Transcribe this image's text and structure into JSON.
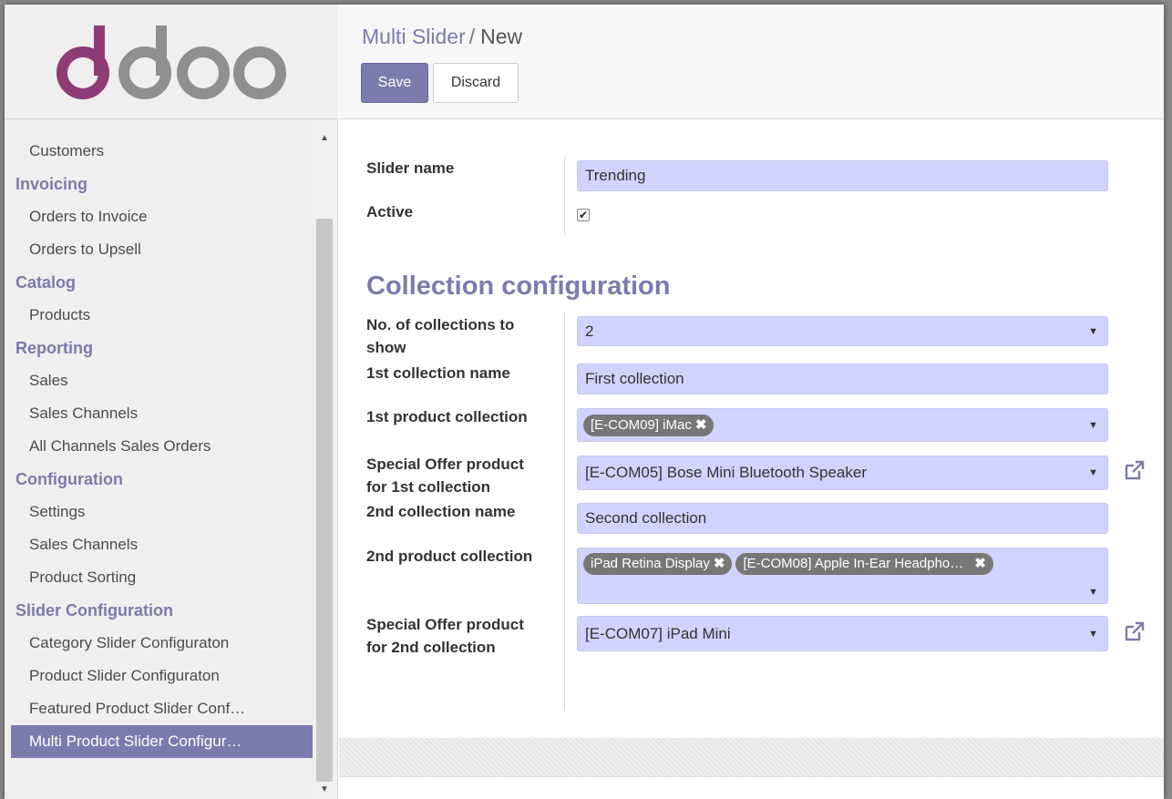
{
  "app": {
    "logo_text": "odoo"
  },
  "sidebar": {
    "groups": [
      {
        "items": [
          "Customers"
        ]
      },
      {
        "title": "Invoicing",
        "items": [
          "Orders to Invoice",
          "Orders to Upsell"
        ]
      },
      {
        "title": "Catalog",
        "items": [
          "Products"
        ]
      },
      {
        "title": "Reporting",
        "items": [
          "Sales",
          "Sales Channels",
          "All Channels Sales Orders"
        ]
      },
      {
        "title": "Configuration",
        "items": [
          "Settings",
          "Sales Channels",
          "Product Sorting"
        ]
      },
      {
        "title": "Slider Configuration",
        "items": [
          "Category Slider Configuraton",
          "Product Slider Configuraton",
          "Featured Product Slider Conf…",
          "Multi Product Slider Configur…"
        ]
      }
    ],
    "active_item": "Multi Product Slider Configur…"
  },
  "breadcrumb": {
    "parent": "Multi Slider",
    "separator": "/",
    "current": "New"
  },
  "toolbar": {
    "save_label": "Save",
    "discard_label": "Discard"
  },
  "form": {
    "slider_name_label": "Slider name",
    "slider_name_value": "Trending",
    "active_label": "Active",
    "active_checked": true,
    "section_title": "Collection configuration",
    "num_collections_label": "No. of collections to show",
    "num_collections_value": "2",
    "first_name_label": "1st collection name",
    "first_name_value": "First collection",
    "first_products_label": "1st product collection",
    "first_products_tags": [
      "[E-COM09] iMac"
    ],
    "first_offer_label": "Special Offer product for 1st collection",
    "first_offer_value": "[E-COM05] Bose Mini Bluetooth Speaker",
    "second_name_label": "2nd collection name",
    "second_name_value": "Second collection",
    "second_products_label": "2nd product collection",
    "second_products_tags": [
      "iPad Retina Display",
      "[E-COM08] Apple In-Ear Headpho…"
    ],
    "second_offer_label": "Special Offer product for 2nd collection",
    "second_offer_value": "[E-COM07] iPad Mini"
  },
  "colors": {
    "brand": "#7c7bad",
    "field_bg": "#d2d2ff",
    "tag_bg": "#777777",
    "logo_purple": "#8f3b76",
    "logo_gray": "#8f8f8f"
  },
  "icons": {
    "external_link": "external-link-icon",
    "dropdown": "caret-down-icon",
    "tag_remove": "times-icon"
  }
}
